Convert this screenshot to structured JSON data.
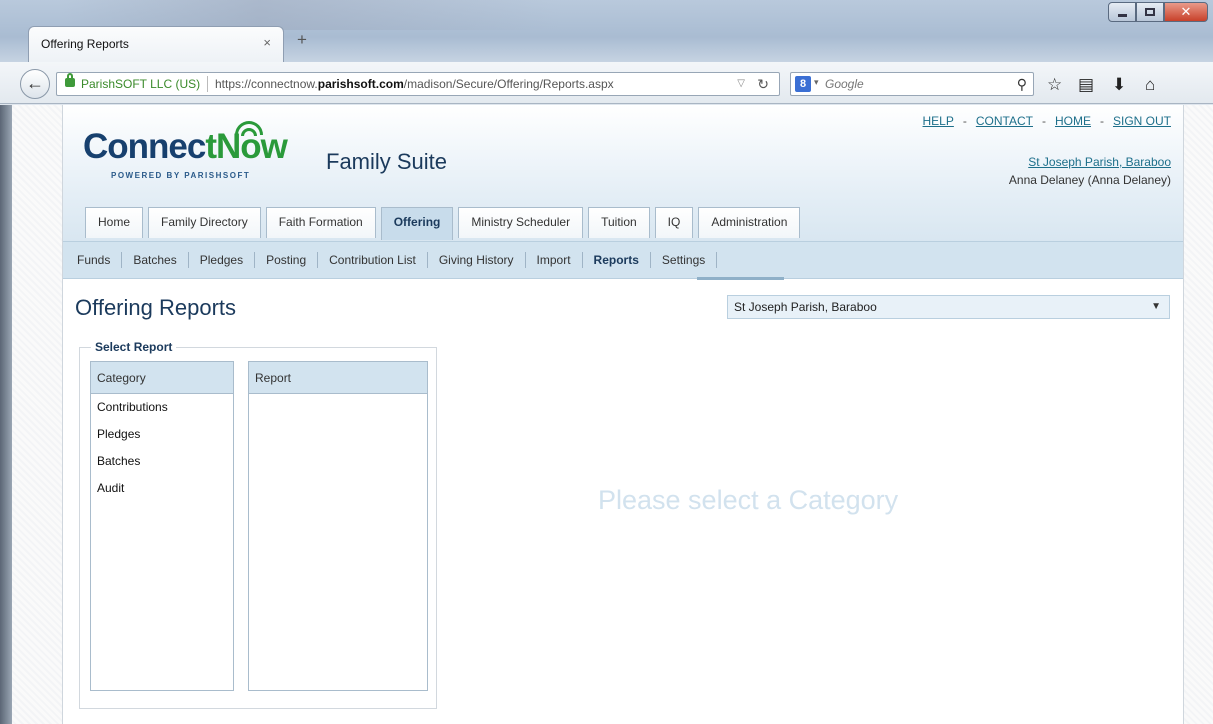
{
  "browser": {
    "tab_title": "Offering Reports",
    "tab_close": "×",
    "new_tab": "+",
    "identity": "ParishSOFT LLC (US)",
    "url_prefix": "https://connectnow.",
    "url_domain": "parishsoft.com",
    "url_path": "/madison/Secure/Offering/Reports.aspx",
    "search_placeholder": "Google",
    "search_engine_glyph": "8"
  },
  "header": {
    "logo_part1": "Connec",
    "logo_part2": "t",
    "logo_part3": "Now",
    "logo_powered": "POWERED BY PARISHSOFT",
    "suite_title": "Family Suite",
    "links": {
      "help": "HELP",
      "contact": "CONTACT",
      "home": "HOME",
      "sign_out": "SIGN OUT",
      "separator": "-"
    },
    "parish_link": "St Joseph Parish, Baraboo",
    "user_line": "Anna Delaney (Anna Delaney)"
  },
  "main_tabs": [
    "Home",
    "Family Directory",
    "Faith Formation",
    "Offering",
    "Ministry Scheduler",
    "Tuition",
    "IQ",
    "Administration"
  ],
  "active_main_tab": "Offering",
  "sub_nav": [
    "Funds",
    "Batches",
    "Pledges",
    "Posting",
    "Contribution List",
    "Giving History",
    "Import",
    "Reports",
    "Settings"
  ],
  "active_sub_nav": "Reports",
  "page": {
    "title": "Offering Reports",
    "parish_select": "St Joseph Parish, Baraboo",
    "select_report_legend": "Select Report",
    "category_header": "Category",
    "report_header": "Report",
    "categories": [
      "Contributions",
      "Pledges",
      "Batches",
      "Audit"
    ],
    "empty_message": "Please select a Category"
  },
  "colors": {
    "brand_blue": "#17406e",
    "brand_green": "#2a9a3a",
    "nav_band": "#d2e3ef",
    "link": "#1d6f8a"
  }
}
